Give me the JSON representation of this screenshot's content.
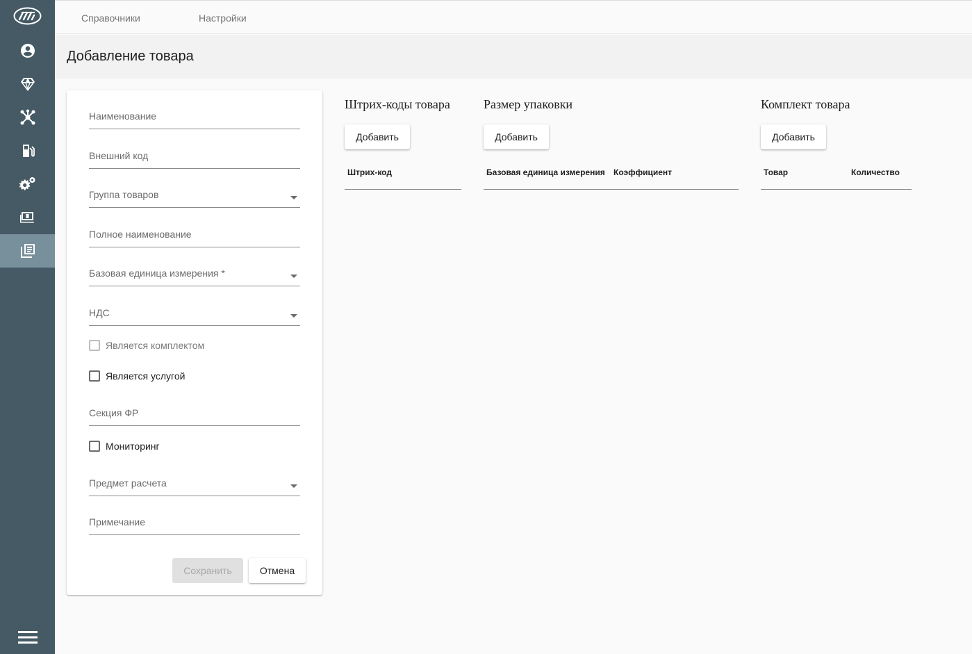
{
  "sidebar": {
    "items": [
      {
        "icon": "account-circle-icon"
      },
      {
        "icon": "diamond-icon"
      },
      {
        "icon": "network-icon"
      },
      {
        "icon": "fuel-pump-icon"
      },
      {
        "icon": "gears-icon"
      },
      {
        "icon": "cash-register-icon"
      },
      {
        "icon": "library-books-icon",
        "active": true
      }
    ],
    "menu_icon": "menu-icon"
  },
  "topnav": {
    "items": [
      "Справочники",
      "Настройки"
    ]
  },
  "page": {
    "title": "Добавление товара"
  },
  "form": {
    "fields": {
      "name": "Наименование",
      "external_code": "Внешний код",
      "product_group": "Группа товаров",
      "full_name": "Полное наименование",
      "base_unit": "Базовая единица измерения *",
      "vat": "НДС",
      "fr_section": "Секция ФР",
      "payment_subject": "Предмет расчета",
      "note": "Примечание"
    },
    "checkboxes": {
      "is_kit": {
        "label": "Является комплектом",
        "checked": false,
        "disabled": true
      },
      "is_service": {
        "label": "Является услугой",
        "checked": false
      },
      "monitoring": {
        "label": "Мониторинг",
        "checked": false
      }
    },
    "buttons": {
      "save": "Сохранить",
      "cancel": "Отмена"
    }
  },
  "barcodes": {
    "title": "Штрих-коды товара",
    "add": "Добавить",
    "columns": [
      "Штрих-код"
    ]
  },
  "package_size": {
    "title": "Размер упаковки",
    "add": "Добавить",
    "columns": [
      "Базовая единица измерения",
      "Коэффициент"
    ]
  },
  "kit": {
    "title": "Комплект товара",
    "add": "Добавить",
    "columns": [
      "Товар",
      "Количество"
    ]
  },
  "colors": {
    "sidebar": "#455a64",
    "sidebar_active": "#78909c"
  }
}
